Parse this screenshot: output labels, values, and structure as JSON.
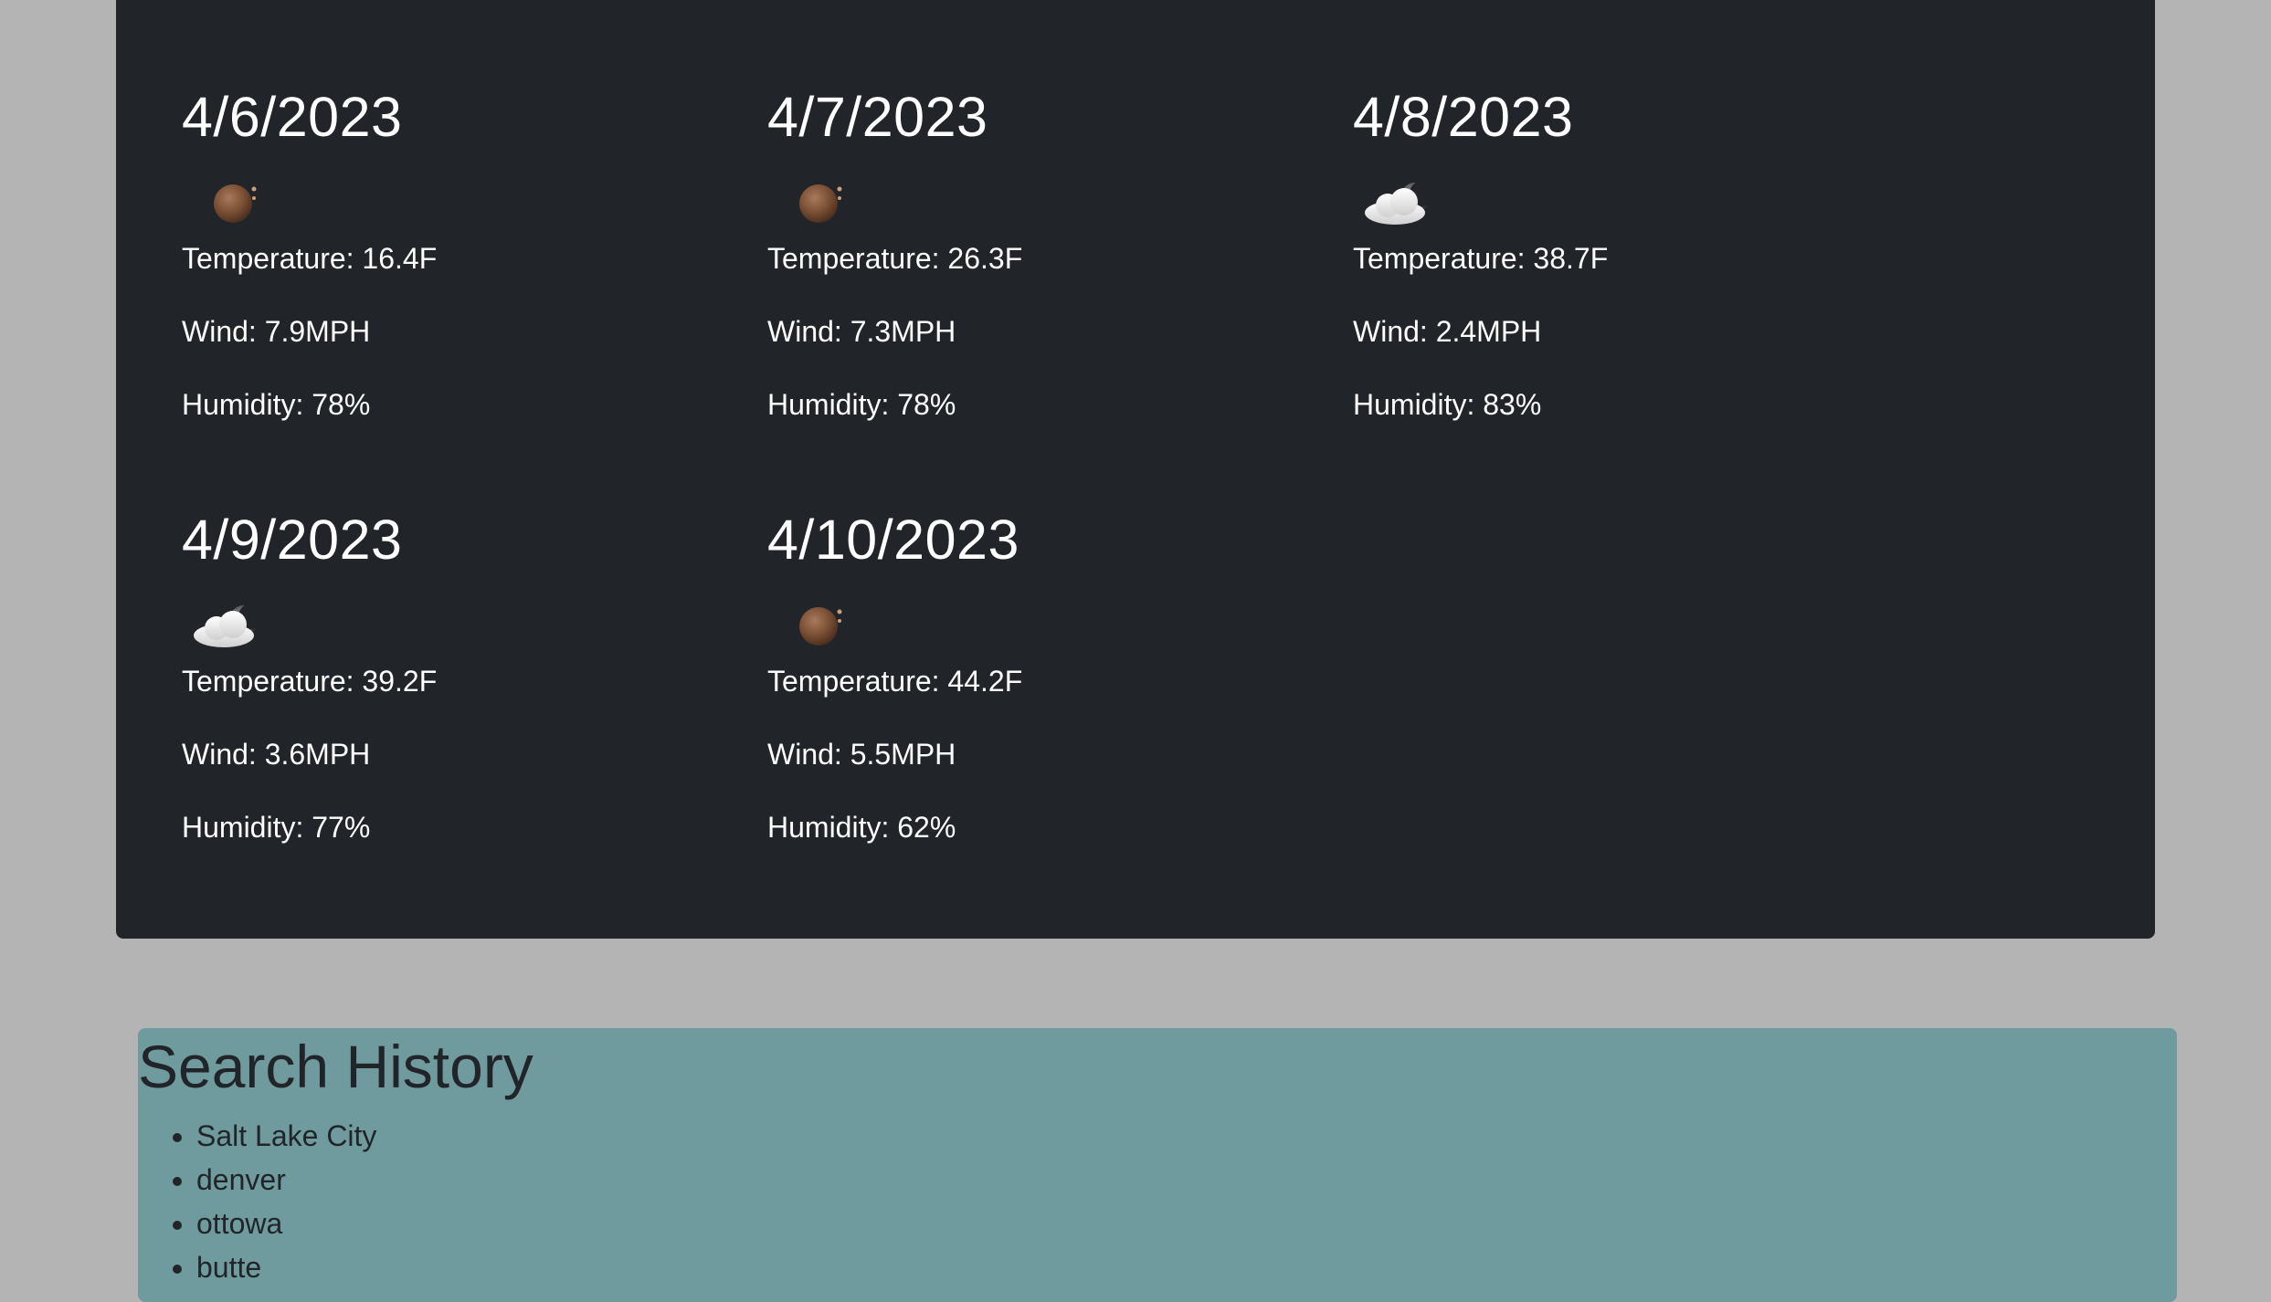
{
  "forecast": {
    "days": [
      {
        "date": "4/6/2023",
        "icon": "moon-icon",
        "temperature": "Temperature: 16.4F",
        "wind": "Wind: 7.9MPH",
        "humidity": "Humidity: 78%"
      },
      {
        "date": "4/7/2023",
        "icon": "moon-icon",
        "temperature": "Temperature: 26.3F",
        "wind": "Wind: 7.3MPH",
        "humidity": "Humidity: 78%"
      },
      {
        "date": "4/8/2023",
        "icon": "cloud-moon-icon",
        "temperature": "Temperature: 38.7F",
        "wind": "Wind: 2.4MPH",
        "humidity": "Humidity: 83%"
      },
      {
        "date": "4/9/2023",
        "icon": "cloud-moon-icon",
        "temperature": "Temperature: 39.2F",
        "wind": "Wind: 3.6MPH",
        "humidity": "Humidity: 77%"
      },
      {
        "date": "4/10/2023",
        "icon": "moon-icon",
        "temperature": "Temperature: 44.2F",
        "wind": "Wind: 5.5MPH",
        "humidity": "Humidity: 62%"
      }
    ]
  },
  "history": {
    "title": "Search History",
    "items": [
      "Salt Lake City",
      "denver",
      "ottowa",
      "butte"
    ]
  },
  "colors": {
    "page_background": "#b4b4b4",
    "forecast_background": "#212529",
    "history_background": "#6f9b9e",
    "text_light": "#ffffff",
    "text_dark": "#212529"
  }
}
